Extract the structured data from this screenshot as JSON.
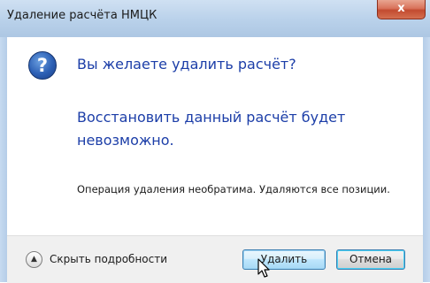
{
  "window": {
    "title": "Удаление расчёта НМЦК",
    "close_glyph": "x"
  },
  "dialog": {
    "icon": "question-icon",
    "icon_glyph": "?",
    "main_instruction": "Вы желаете удалить расчёт?",
    "content": "Восстановить данный расчёт будет невозможно.",
    "details": "Операция удаления необратима. Удаляются все позиции."
  },
  "footer": {
    "toggle_icon": "chevron-up-icon",
    "toggle_glyph": "▲",
    "toggle_label": "Скрыть подробности",
    "delete_button": "Удалить",
    "cancel_button": "Отмена"
  },
  "colors": {
    "instruction_text": "#1c3ea8",
    "titlebar": "#b9d1ea",
    "close_button": "#c24b30",
    "footer_background": "#f0f0f0"
  }
}
